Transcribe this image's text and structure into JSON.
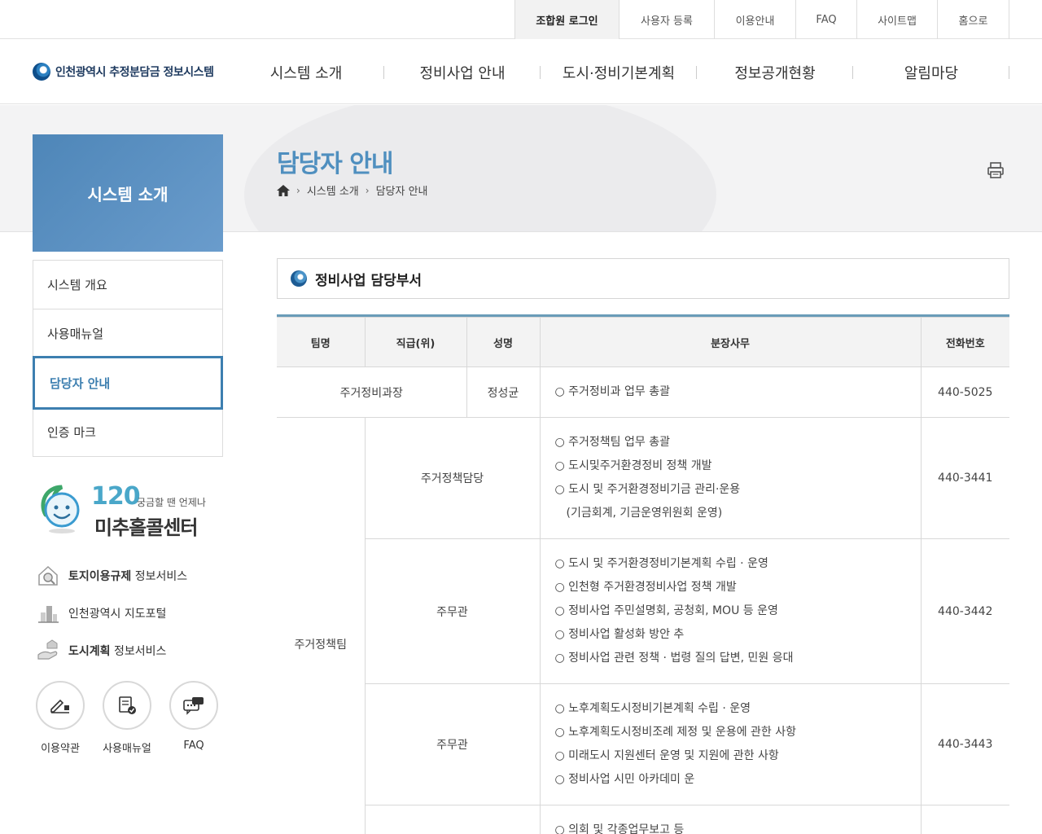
{
  "util_nav": [
    {
      "label": "조합원 로그인",
      "active": true
    },
    {
      "label": "사용자 등록",
      "active": false
    },
    {
      "label": "이용안내",
      "active": false
    },
    {
      "label": "FAQ",
      "active": false
    },
    {
      "label": "사이트맵",
      "active": false
    },
    {
      "label": "홈으로",
      "active": false
    }
  ],
  "logo": {
    "text": "인천광역시 추정분담금 정보시스템"
  },
  "gnb": [
    "시스템 소개",
    "정비사업 안내",
    "도시·정비기본계획",
    "정보공개현황",
    "알림마당"
  ],
  "page": {
    "title": "담당자 안내",
    "breadcrumb": [
      "시스템 소개",
      "담당자 안내"
    ]
  },
  "lnb": {
    "title": "시스템 소개",
    "items": [
      "시스템 개요",
      "사용매뉴얼",
      "담당자 안내",
      "인증 마크"
    ],
    "active_index": 2
  },
  "callcenter": {
    "number": "120",
    "subtitle": "궁금할 땐 언제나",
    "name": "미추홀콜센터"
  },
  "quick_links": [
    {
      "bold": "토지이용규제",
      "rest": " 정보서비스",
      "icon": "house-search-icon"
    },
    {
      "bold": "",
      "rest": "인천광역시 지도포털",
      "icon": "city-building-icon"
    },
    {
      "bold": "도시계획",
      "rest": " 정보서비스",
      "icon": "hand-house-icon"
    }
  ],
  "circle_links": [
    {
      "label": "이용약관",
      "icon": "pen-sign-icon"
    },
    {
      "label": "사용매뉴얼",
      "icon": "manual-check-icon"
    },
    {
      "label": "FAQ",
      "icon": "chat-bubble-icon"
    }
  ],
  "section": {
    "title": "정비사업 담당부서"
  },
  "table": {
    "headers": [
      "팀명",
      "직급(위)",
      "성명",
      "분장사무",
      "전화번호"
    ],
    "row1": {
      "team": "주거정비과장",
      "name": "정성균",
      "duties": [
        "○ 주거정비과 업무 총괄"
      ],
      "phone": "440-5025"
    },
    "group_team": "주거정책팀",
    "group_rows": [
      {
        "rank": "주거정책담당",
        "duties": [
          "○ 주거정책팀 업무 총괄",
          "○ 도시및주거환경정비 정책 개발",
          "○ 도시 및 주거환경정비기금 관리·운용",
          "(기금회계, 기금운영위원회 운영)"
        ],
        "phone": "440-3441"
      },
      {
        "rank": "주무관",
        "duties": [
          "○ 도시 및 주거환경정비기본계획 수립 · 운영",
          "○ 인천형 주거환경정비사업 정책 개발",
          "○ 정비사업 주민설명회, 공청회, MOU 등 운영",
          "○ 정비사업 활성화 방안 추",
          "○ 정비사업 관련 정책 · 법령 질의 답변, 민원 응대"
        ],
        "phone": "440-3442"
      },
      {
        "rank": "주무관",
        "duties": [
          "○ 노후계획도시정비기본계획 수립 · 운영",
          "○ 노후계획도시정비조례 제정 및 운용에 관한 사항",
          "○ 미래도시 지원센터 운영 및 지원에 관한 사항",
          "○ 정비사업 시민 아카데미 운"
        ],
        "phone": "440-3443"
      },
      {
        "rank": "",
        "duties": [
          "○ 의회 및 각종업무보고 등"
        ],
        "phone": ""
      }
    ]
  }
}
